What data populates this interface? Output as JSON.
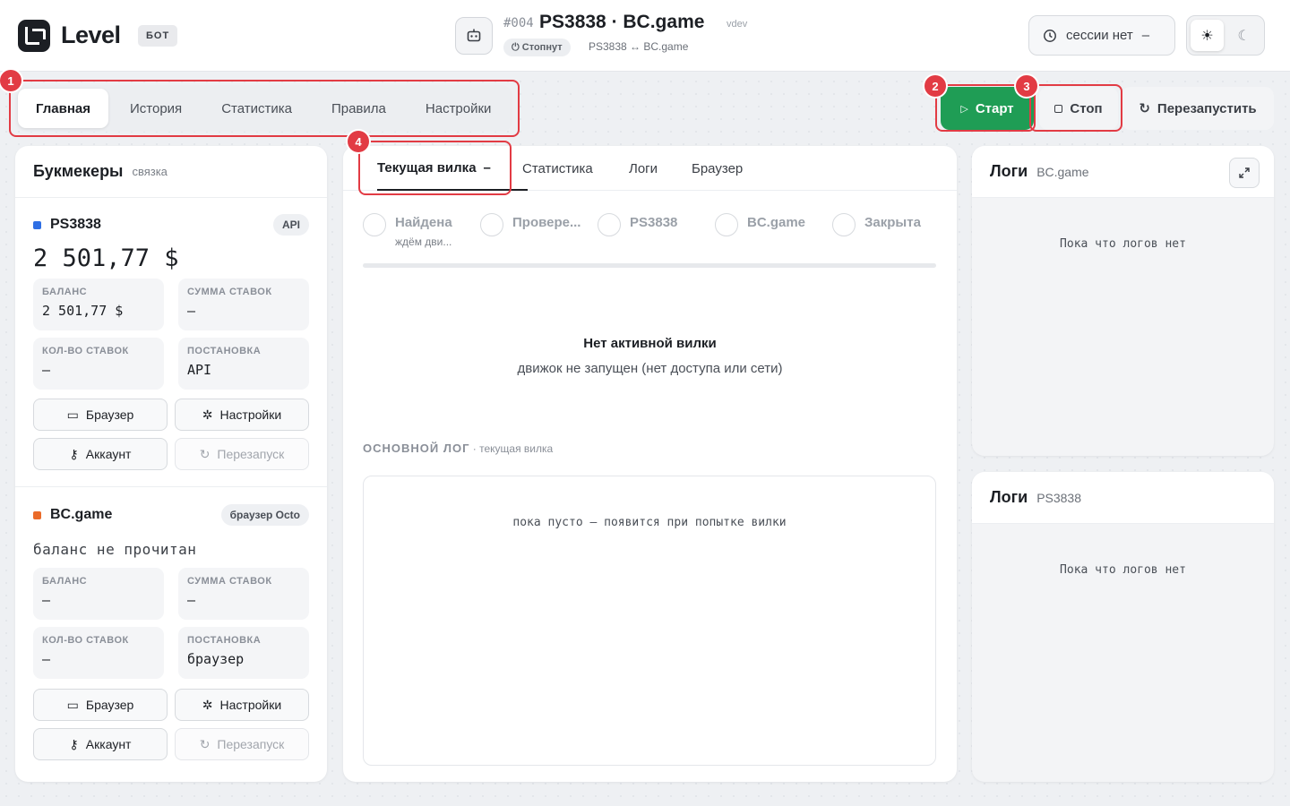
{
  "header": {
    "brand": "Level",
    "badge": "БОТ",
    "code": "#004",
    "title": "PS3838 · BC.game",
    "env": "vdev",
    "status": "Стопнут",
    "pair": "PS3838 ↔ BC.game",
    "session_label": "сессии нет",
    "session_value": "–"
  },
  "main_tabs": [
    "Главная",
    "История",
    "Статистика",
    "Правила",
    "Настройки"
  ],
  "controls": {
    "start": "Старт",
    "stop": "Стоп",
    "restart": "Перезапустить"
  },
  "books": {
    "title": "Букмекеры",
    "subtitle": "связка",
    "items": [
      {
        "name": "PS3838",
        "color": "#2f6fe4",
        "tag": "API",
        "balance": "2 501,77 $",
        "stats": [
          {
            "k": "Баланс",
            "v": "2 501,77 $"
          },
          {
            "k": "Сумма ставок",
            "v": "–"
          },
          {
            "k": "Кол-во ставок",
            "v": "–"
          },
          {
            "k": "Постановка",
            "v": "API"
          }
        ],
        "buttons": [
          "Браузер",
          "Настройки",
          "Аккаунт",
          "Перезапуск"
        ]
      },
      {
        "name": "BC.game",
        "color": "#ea6b2a",
        "tag": "браузер Octo",
        "balance": "баланс не прочитан",
        "stats": [
          {
            "k": "Баланс",
            "v": "–"
          },
          {
            "k": "Сумма ставок",
            "v": "–"
          },
          {
            "k": "Кол-во ставок",
            "v": "–"
          },
          {
            "k": "Постановка",
            "v": "браузер"
          }
        ],
        "buttons": [
          "Браузер",
          "Настройки",
          "Аккаунт",
          "Перезапуск"
        ]
      }
    ]
  },
  "center": {
    "tabs": [
      "Текущая вилка",
      "Статистика",
      "Логи",
      "Браузер"
    ],
    "active_tab_suffix": "–",
    "steps": [
      {
        "title": "Найдена",
        "sub": "ждём дви..."
      },
      {
        "title": "Провере...",
        "sub": ""
      },
      {
        "title": "PS3838",
        "sub": ""
      },
      {
        "title": "BC.game",
        "sub": ""
      },
      {
        "title": "Закрыта",
        "sub": ""
      }
    ],
    "empty_title": "Нет активной вилки",
    "empty_sub": "движок не запущен (нет доступа или сети)",
    "log_label": "ОСНОВНОЙ ЛОГ",
    "log_label_sub": "· текущая вилка",
    "log_empty": "пока пусто — появится при попытке вилки"
  },
  "logs": [
    {
      "title": "Логи",
      "sub": "BC.game",
      "empty": "Пока что логов нет"
    },
    {
      "title": "Логи",
      "sub": "PS3838",
      "empty": "Пока что логов нет"
    }
  ],
  "annotations": [
    "1",
    "2",
    "3",
    "4"
  ],
  "colors": {
    "accent_green": "#1f9d55",
    "highlight_red": "#e23b44"
  }
}
